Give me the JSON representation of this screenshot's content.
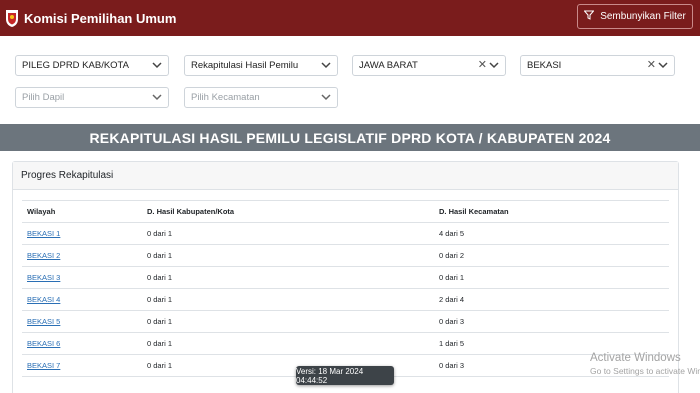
{
  "header": {
    "title": "Komisi Pemilihan Umum",
    "filter_button": "Sembunyikan Filter"
  },
  "filters": {
    "jenis": "PILEG DPRD KAB/KOTA",
    "tahap": "Rekapitulasi Hasil Pemilu",
    "provinsi": "JAWA BARAT",
    "kota": "BEKASI",
    "dapil_placeholder": "Pilih Dapil",
    "kecamatan_placeholder": "Pilih Kecamatan"
  },
  "banner": "REKAPITULASI HASIL PEMILU LEGISLATIF DPRD KOTA / KABUPATEN 2024",
  "card": {
    "title": "Progres Rekapitulasi",
    "columns": [
      "Wilayah",
      "D. Hasil Kabupaten/Kota",
      "D. Hasil Kecamatan"
    ],
    "rows": [
      {
        "wilayah": "BEKASI 1",
        "kab": "0 dari 1",
        "kec": "4 dari 5"
      },
      {
        "wilayah": "BEKASI 2",
        "kab": "0 dari 1",
        "kec": "0 dari 2"
      },
      {
        "wilayah": "BEKASI 3",
        "kab": "0 dari 1",
        "kec": "0 dari 1"
      },
      {
        "wilayah": "BEKASI 4",
        "kab": "0 dari 1",
        "kec": "2 dari 4"
      },
      {
        "wilayah": "BEKASI 5",
        "kab": "0 dari 1",
        "kec": "0 dari 3"
      },
      {
        "wilayah": "BEKASI 6",
        "kab": "0 dari 1",
        "kec": "1 dari 5"
      },
      {
        "wilayah": "BEKASI 7",
        "kab": "0 dari 1",
        "kec": "0 dari 3"
      }
    ]
  },
  "version": "Versi: 18 Mar 2024 04:44:52",
  "watermark": {
    "line1": "Activate Windows",
    "line2": "Go to Settings to activate Windows."
  },
  "colors": {
    "header": "#7a1c1c",
    "banner": "#6c757d",
    "link": "#2a6fb5"
  }
}
